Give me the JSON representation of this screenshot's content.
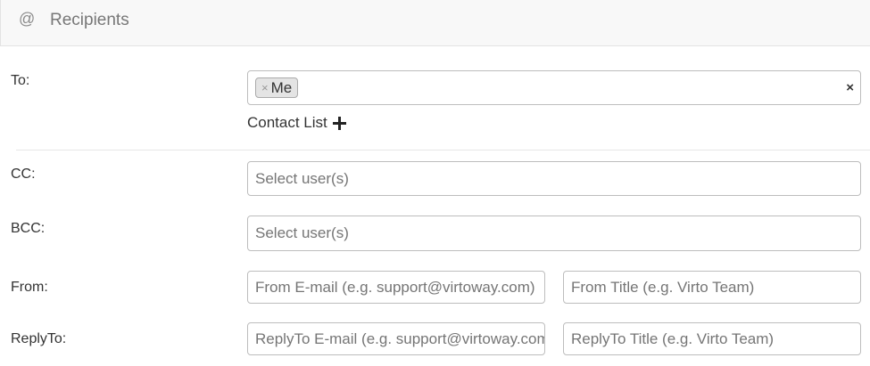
{
  "header": {
    "icon_glyph": "@",
    "title": "Recipients"
  },
  "to": {
    "label": "To:",
    "chips": [
      {
        "remove_glyph": "×",
        "label": "Me"
      }
    ],
    "clear_glyph": "×",
    "contact_list_label": "Contact List"
  },
  "cc": {
    "label": "CC:",
    "placeholder": "Select user(s)"
  },
  "bcc": {
    "label": "BCC:",
    "placeholder": "Select user(s)"
  },
  "from": {
    "label": "From:",
    "email_placeholder": "From E-mail (e.g. support@virtoway.com)",
    "title_placeholder": "From Title (e.g. Virto Team)"
  },
  "replyto": {
    "label": "ReplyTo:",
    "email_placeholder": "ReplyTo E-mail (e.g. support@virtoway.com)",
    "title_placeholder": "ReplyTo Title (e.g. Virto Team)"
  }
}
